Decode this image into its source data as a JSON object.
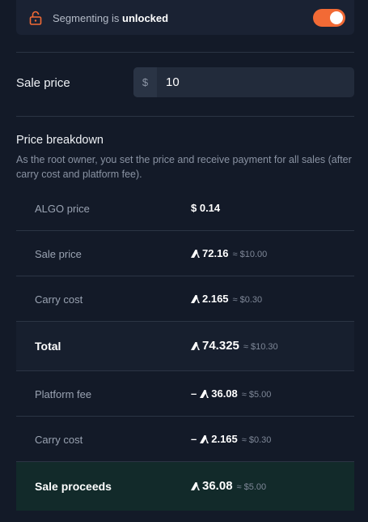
{
  "segmenting": {
    "prefix": "Segmenting is",
    "status": "unlocked",
    "toggle_on": true,
    "accent_color": "#f26a35",
    "icon": "unlocked-lock-icon"
  },
  "sale_price": {
    "label": "Sale price",
    "currency_prefix": "$",
    "value": "10"
  },
  "breakdown": {
    "title": "Price breakdown",
    "description": "As the root owner, you set the price and receive payment for all sales (after carry cost and platform fee).",
    "rows": [
      {
        "label": "ALGO price",
        "sign": "",
        "amount": "$ 0.14",
        "approx": ""
      },
      {
        "label": "Sale price",
        "sign": "",
        "amount": "72.16",
        "approx": "≈ $10.00"
      },
      {
        "label": "Carry cost",
        "sign": "",
        "amount": "2.165",
        "approx": "≈ $0.30"
      },
      {
        "label": "Total",
        "sign": "",
        "amount": "74.325",
        "approx": "≈ $10.30"
      },
      {
        "label": "Platform fee",
        "sign": "–",
        "amount": "36.08",
        "approx": "≈ $5.00"
      },
      {
        "label": "Carry cost",
        "sign": "–",
        "amount": "2.165",
        "approx": "≈ $0.30"
      },
      {
        "label": "Sale proceeds",
        "sign": "",
        "amount": "36.08",
        "approx": "≈ $5.00"
      }
    ]
  }
}
